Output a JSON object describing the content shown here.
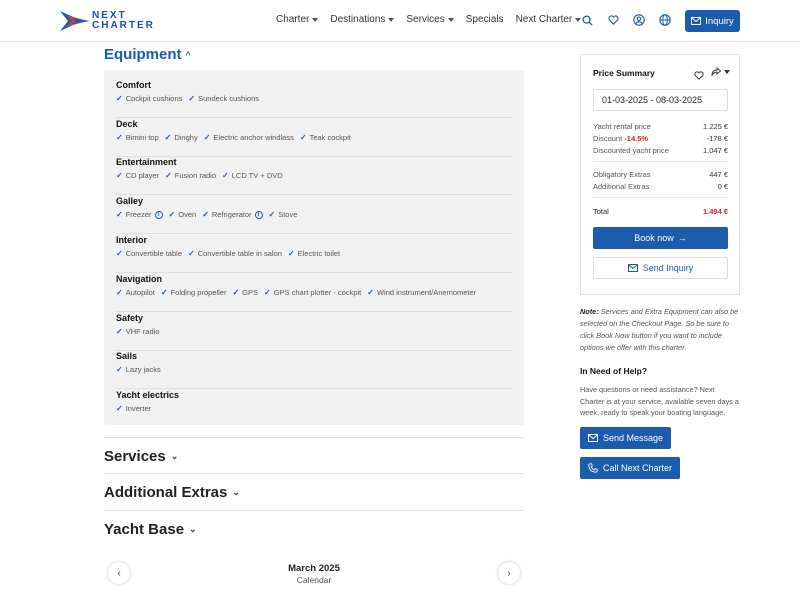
{
  "brand": {
    "logo_line1": "NEXT",
    "logo_line2": "CHARTER"
  },
  "nav": {
    "items": [
      {
        "label": "Charter",
        "has_caret": true
      },
      {
        "label": "Destinations",
        "has_caret": true
      },
      {
        "label": "Services",
        "has_caret": true
      },
      {
        "label": "Specials",
        "has_caret": false
      },
      {
        "label": "Next Charter",
        "has_caret": true
      }
    ],
    "icons": [
      "search-icon",
      "heart-icon",
      "user-icon",
      "globe-icon"
    ],
    "inquiry_label": "Inquiry"
  },
  "equipment": {
    "title": "Equipment",
    "groups": [
      {
        "title": "Comfort",
        "items": [
          "Cockpit cushions",
          "Sundeck cushions"
        ]
      },
      {
        "title": "Deck",
        "items": [
          "Bimini top",
          "Dinghy",
          "Electric anchor windlass",
          "Teak cockpit"
        ]
      },
      {
        "title": "Entertainment",
        "items": [
          "CD player",
          "Fusion radio",
          "LCD TV + DVD"
        ]
      },
      {
        "title": "Galley",
        "items": [
          "Freezer",
          "Oven",
          "Refrigerator",
          "Stove"
        ]
      },
      {
        "title": "Interior",
        "items": [
          "Convertible table",
          "Convertible table in salon",
          "Electric toilet"
        ]
      },
      {
        "title": "Navigation",
        "items": [
          "Autopilot",
          "Folding propeller",
          "GPS",
          "GPS chart plotter - cockpit",
          "Wind instrument/Anemometer"
        ]
      },
      {
        "title": "Safety",
        "items": [
          "VHF radio"
        ]
      },
      {
        "title": "Sails",
        "items": [
          "Lazy jacks"
        ]
      },
      {
        "title": "Yacht electrics",
        "items": [
          "Inverter"
        ]
      }
    ]
  },
  "sections": {
    "services": "Services",
    "extras": "Additional Extras",
    "base": "Yacht Base"
  },
  "calendar": {
    "month": "March 2025",
    "subtitle": "Calendar"
  },
  "price_summary": {
    "title": "Price Summary",
    "dates": "01-03-2025 - 08-03-2025",
    "rental_label": "Yacht rental price",
    "rental_value": "1.225 €",
    "discount_label": "Discount",
    "discount_pct": "-14.5%",
    "discount_value": "-178 €",
    "discounted_label": "Discounted yacht price",
    "discounted_value": "1.047 €",
    "obligatory_label": "Obligatory Extras",
    "obligatory_value": "447 €",
    "additional_label": "Additional Extras",
    "additional_value": "0 €",
    "total_label": "Total",
    "total_value": "1.494 €",
    "book_label": "Book now",
    "send_label": "Send Inquiry"
  },
  "note": {
    "lead": "Note:",
    "text": "Services and Extra Equipment can also be selected on the Checkout Page. So be sure to click Book Now button if you want to include options we offer with this charter."
  },
  "help": {
    "title": "In Need of Help?",
    "text": "Have questions or need assistance? Next Charter is at your service, available seven days a week, ready to speak your boating language.",
    "message_label": "Send Message",
    "call_label": "Call Next Charter"
  },
  "colors": {
    "brand_blue": "#1b5cac",
    "discount_red": "#d22222"
  }
}
